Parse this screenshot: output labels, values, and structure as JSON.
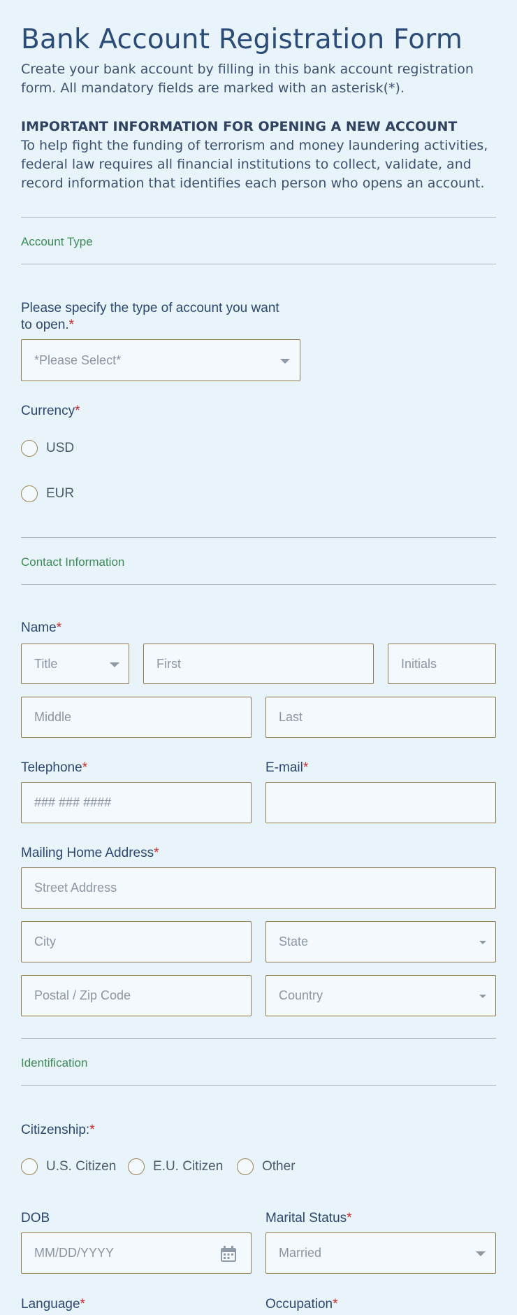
{
  "header": {
    "title": "Bank Account Registration Form",
    "subtitle": "Create your bank account by filling in this bank account registration form. All mandatory fields are marked with an asterisk(*).",
    "important_heading": "IMPORTANT INFORMATION FOR OPENING A NEW ACCOUNT",
    "important_text": "To help fight the funding of terrorism and money laundering activities, federal law requires all financial institutions to collect, validate, and record information that identifies each person who opens an account."
  },
  "sections": {
    "account_type": "Account Type",
    "contact": "Contact Information",
    "identification": "Identification"
  },
  "account": {
    "type_question": "Please specify the type of account you want to open.",
    "type_placeholder": "*Please Select*",
    "currency_label": "Currency",
    "currency_options": [
      "USD",
      "EUR"
    ]
  },
  "contact": {
    "name_label": "Name",
    "title_placeholder": "Title",
    "first_placeholder": "First",
    "initials_placeholder": "Initials",
    "middle_placeholder": "Middle",
    "last_placeholder": "Last",
    "telephone_label": "Telephone",
    "telephone_placeholder": "### ### ####",
    "email_label": "E-mail",
    "email_value": "",
    "address_label": "Mailing Home Address",
    "street_placeholder": "Street Address",
    "city_placeholder": "City",
    "state_placeholder": "State",
    "zip_placeholder": "Postal / Zip Code",
    "country_placeholder": "Country"
  },
  "identification": {
    "citizenship_label": "Citizenship:",
    "citizenship_options": [
      "U.S. Citizen",
      "E.U. Citizen",
      "Other"
    ],
    "dob_label": "DOB",
    "dob_placeholder": "MM/DD/YYYY",
    "marital_label": "Marital Status",
    "marital_value": "Married",
    "language_label": "Language",
    "occupation_label": "Occupation"
  },
  "required_mark": "*",
  "colors": {
    "background": "#e8f3fa",
    "accent_green": "#3d8b57",
    "required_red": "#d12a2a",
    "field_border": "#8f7c4e"
  },
  "icons": {
    "dropdown": "caret-down-icon",
    "calendar": "calendar-icon"
  }
}
